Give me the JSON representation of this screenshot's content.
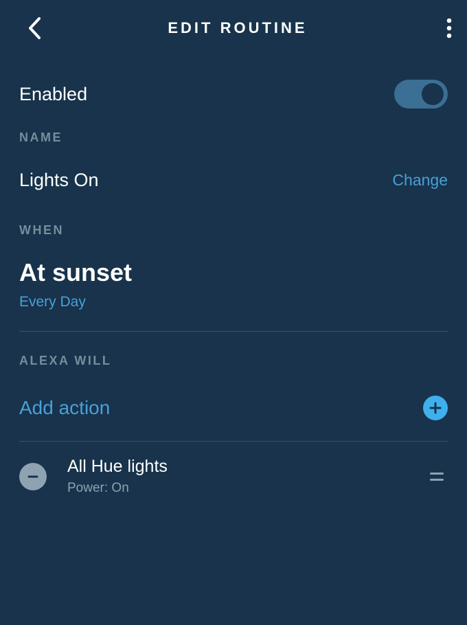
{
  "header": {
    "title": "EDIT ROUTINE"
  },
  "enabled": {
    "label": "Enabled",
    "state": "on"
  },
  "name_section": {
    "heading": "NAME",
    "value": "Lights On",
    "change_label": "Change"
  },
  "when_section": {
    "heading": "WHEN",
    "trigger": "At sunset",
    "recurrence": "Every Day"
  },
  "actions_section": {
    "heading": "ALEXA WILL",
    "add_label": "Add action",
    "items": [
      {
        "title": "All Hue lights",
        "subtitle": "Power: On"
      }
    ]
  },
  "colors": {
    "accent": "#49a0d9",
    "bg": "#18334b",
    "muted": "#8ea2b2"
  }
}
